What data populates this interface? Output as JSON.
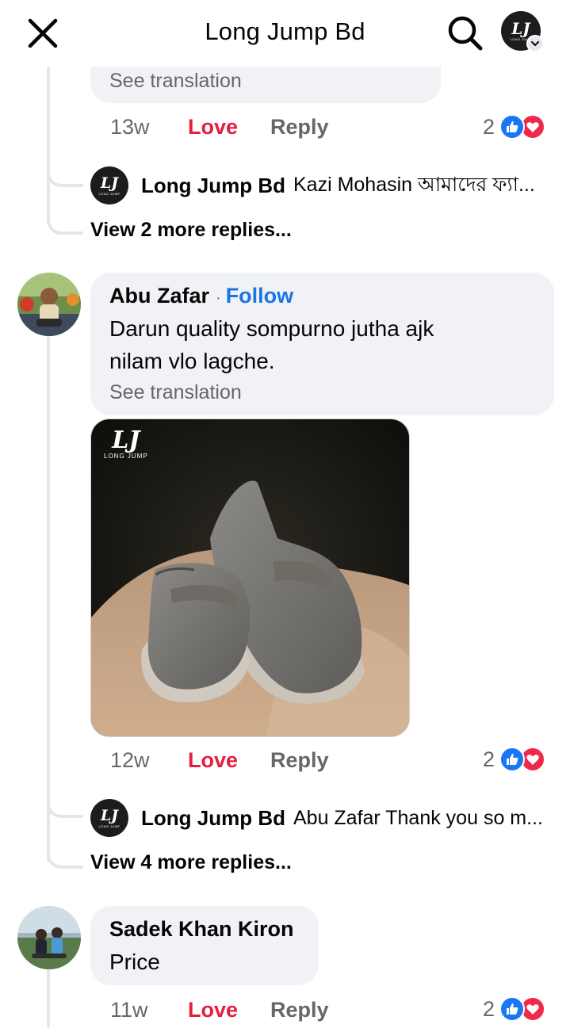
{
  "header": {
    "title": "Long Jump Bd",
    "close_icon": "close-icon",
    "search_icon": "search-icon",
    "avatar_logo_text": "LJ"
  },
  "thread1": {
    "see_translation": "See translation",
    "time": "13w",
    "love": "Love",
    "reply": "Reply",
    "reactions": "2",
    "reply_preview": {
      "author": "Long Jump Bd",
      "text": "Kazi Mohasin  আমাদের ফ্যা..."
    },
    "more_replies": "View 2 more replies..."
  },
  "comment2": {
    "author": "Abu Zafar",
    "follow": "Follow",
    "text_line1": "Darun quality sompurno jutha ajk",
    "text_line2": "nilam vlo lagche.",
    "see_translation": "See translation",
    "photo_logo": "LJ",
    "photo_logo_sub": "LONG JUMP",
    "time": "12w",
    "love": "Love",
    "reply": "Reply",
    "reactions": "2",
    "reply_preview": {
      "author": "Long Jump Bd",
      "text": "Abu Zafar Thank you so m..."
    },
    "more_replies": "View 4 more replies..."
  },
  "comment3": {
    "author": "Sadek Khan Kiron",
    "text": "Price",
    "time": "11w",
    "love": "Love",
    "reply": "Reply",
    "reactions": "2"
  },
  "colors": {
    "love": "#e41e3f",
    "follow": "#1b74e4",
    "like_badge": "#1877f2",
    "heart_badge": "#f02849",
    "bubble": "#f0f2f5"
  },
  "logo_sub": "LONG JUMP"
}
